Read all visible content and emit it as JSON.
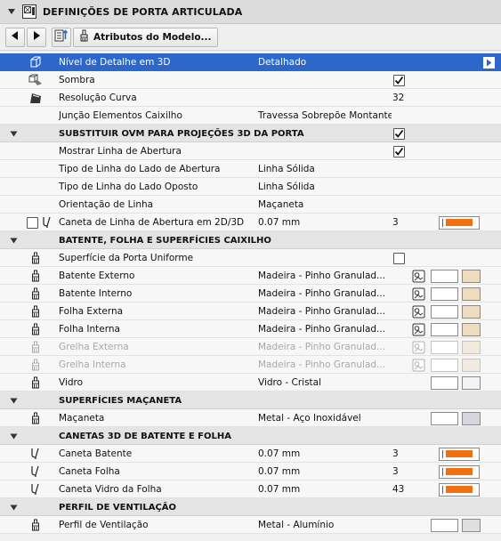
{
  "panel": {
    "title": "DEFINIÇÕES DE PORTA ARTICULADA",
    "toolbar": {
      "model_attributes_label": "Atributos do Modelo..."
    }
  },
  "colors": {
    "selection": "#2c67c9",
    "pen_orange": "#f07010",
    "wood_swatch": "#eedcc0",
    "handle_swatch": "#d8d6dc",
    "vent_swatch": "#e2dde0"
  },
  "rows": [
    {
      "type": "param",
      "icon": "cube-icon",
      "name": "Nível de Detalhe em 3D",
      "value": "Detalhado",
      "selected": true
    },
    {
      "type": "param",
      "icon": "shadow-icon",
      "name": "Sombra",
      "checked": true
    },
    {
      "type": "param",
      "icon": "curve-resolution-icon",
      "name": "Resolução Curva",
      "number": "32"
    },
    {
      "type": "param",
      "name": "Junção Elementos Caixilho",
      "value": "Travessa Sobrepõe Montante"
    },
    {
      "type": "section",
      "name": "SUBSTITUIR OVM PARA PROJEÇÕES 3D DA PORTA",
      "checked": true
    },
    {
      "type": "param",
      "name": "Mostrar Linha de Abertura",
      "checked": true
    },
    {
      "type": "param",
      "name": "Tipo de Linha do Lado de Abertura",
      "value": "Linha Sólida"
    },
    {
      "type": "param",
      "name": "Tipo de Linha do Lado Oposto",
      "value": "Linha Sólida"
    },
    {
      "type": "param",
      "name": "Orientação de Linha",
      "value": "Maçaneta"
    },
    {
      "type": "param",
      "icon": "pen-icon",
      "name": "Caneta de Linha de Abertura em 2D/3D",
      "value": "0.07 mm",
      "number": "3",
      "pen": true,
      "leading_checkbox": true
    },
    {
      "type": "section",
      "name": "BATENTE, FOLHA E SUPERFÍCIES CAIXILHO"
    },
    {
      "type": "param",
      "icon": "brush-icon",
      "name": "Superfície da Porta Uniforme",
      "checked": false
    },
    {
      "type": "param",
      "icon": "brush-icon",
      "name": "Batente Externo",
      "value": "Madeira - Pinho Granulad...",
      "material": true
    },
    {
      "type": "param",
      "icon": "brush-icon",
      "name": "Batente Interno",
      "value": "Madeira - Pinho Granulad...",
      "material": true
    },
    {
      "type": "param",
      "icon": "brush-icon",
      "name": "Folha Externa",
      "value": "Madeira - Pinho Granulad...",
      "material": true
    },
    {
      "type": "param",
      "icon": "brush-icon",
      "name": "Folha Interna",
      "value": "Madeira - Pinho Granulad...",
      "material": true
    },
    {
      "type": "param",
      "icon": "brush-icon",
      "name": "Grelha Externa",
      "value": "Madeira - Pinho Granulad...",
      "material": true,
      "disabled": true
    },
    {
      "type": "param",
      "icon": "brush-icon",
      "name": "Grelha Interna",
      "value": "Madeira - Pinho Granulad...",
      "material": true,
      "disabled": true
    },
    {
      "type": "param",
      "icon": "brush-icon",
      "name": "Vidro",
      "value": "Vidro - Cristal",
      "material_noicon": true,
      "swatch": "#f4f4f4"
    },
    {
      "type": "section",
      "name": "SUPERFÍCIES MAÇANETA"
    },
    {
      "type": "param",
      "icon": "brush-icon",
      "name": "Maçaneta",
      "value": "Metal - Aço Inoxidável",
      "material_noicon": true,
      "swatch": "#d8d6dc"
    },
    {
      "type": "section",
      "name": "CANETAS 3D DE BATENTE E FOLHA"
    },
    {
      "type": "param",
      "icon": "pen-icon",
      "name": "Caneta Batente",
      "value": "0.07 mm",
      "number": "3",
      "pen": true
    },
    {
      "type": "param",
      "icon": "pen-icon",
      "name": "Caneta Folha",
      "value": "0.07 mm",
      "number": "3",
      "pen": true
    },
    {
      "type": "param",
      "icon": "pen-icon",
      "name": "Caneta Vidro da Folha",
      "value": "0.07 mm",
      "number": "43",
      "pen": true
    },
    {
      "type": "section",
      "name": "PERFIL DE VENTILAÇÃO"
    },
    {
      "type": "param",
      "icon": "brush-icon",
      "name": "Perfil de Ventilação",
      "value": "Metal - Alumínio",
      "material_noicon": true,
      "swatch": "#e2dde0"
    }
  ]
}
